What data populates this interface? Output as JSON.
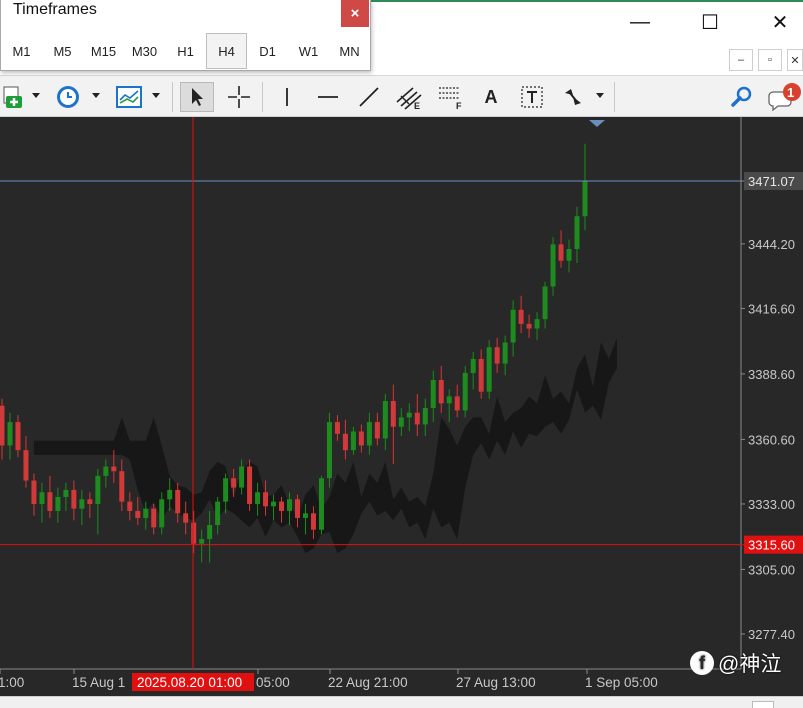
{
  "timeframes": {
    "title": "Timeframes",
    "close_label": "×",
    "items": [
      {
        "label": "M1",
        "active": false
      },
      {
        "label": "M5",
        "active": false
      },
      {
        "label": "M15",
        "active": false
      },
      {
        "label": "M30",
        "active": false
      },
      {
        "label": "H1",
        "active": false
      },
      {
        "label": "H4",
        "active": true
      },
      {
        "label": "D1",
        "active": false
      },
      {
        "label": "W1",
        "active": false
      },
      {
        "label": "MN",
        "active": false
      }
    ]
  },
  "window": {
    "minimize": "—",
    "maximize": "☐",
    "close": "✕",
    "mdi_minimize": "–",
    "mdi_restore": "▫",
    "mdi_close": "✕"
  },
  "toolbar": {
    "tools": [
      "new-chart",
      "periodicity",
      "templates",
      "cursor",
      "crosshair",
      "vertical-line",
      "horizontal-line",
      "trendline",
      "equidistant-channel",
      "fibonacci",
      "text",
      "text-label",
      "arrows"
    ],
    "text_tool_label": "A",
    "notification_count": "1"
  },
  "colors": {
    "bull": "#1f8a1f",
    "bear": "#d03a3a",
    "background": "#282828",
    "cloud": "#141414",
    "price_line": "#6c8ebf",
    "crosshair": "#e01010"
  },
  "chart_data": {
    "type": "candlestick",
    "symbol_timeframe": "H4",
    "price_scale": [
      "3471.07",
      "3444.20",
      "3416.60",
      "3388.60",
      "3360.60",
      "3333.00",
      "3305.00",
      "3277.40"
    ],
    "current_price": "3471.07",
    "crosshair_price": "3315.60",
    "crosshair_time": "2025.08.20 01:00",
    "time_labels": [
      "1:00",
      "15 Aug 1",
      "05:00",
      "22 Aug 21:00",
      "27 Aug 13:00",
      "1 Sep 05:00"
    ],
    "ohlc": [
      [
        3375,
        3378,
        3352,
        3358
      ],
      [
        3358,
        3372,
        3352,
        3368
      ],
      [
        3368,
        3371,
        3353,
        3356
      ],
      [
        3356,
        3362,
        3340,
        3343
      ],
      [
        3343,
        3346,
        3328,
        3333
      ],
      [
        3333,
        3342,
        3325,
        3338
      ],
      [
        3338,
        3345,
        3327,
        3330
      ],
      [
        3330,
        3340,
        3325,
        3336
      ],
      [
        3336,
        3342,
        3330,
        3339
      ],
      [
        3339,
        3343,
        3326,
        3331
      ],
      [
        3331,
        3339,
        3324,
        3335
      ],
      [
        3335,
        3338,
        3327,
        3333
      ],
      [
        3333,
        3348,
        3320,
        3345
      ],
      [
        3345,
        3352,
        3340,
        3349
      ],
      [
        3349,
        3356,
        3342,
        3347
      ],
      [
        3347,
        3352,
        3330,
        3334
      ],
      [
        3334,
        3338,
        3326,
        3330
      ],
      [
        3330,
        3336,
        3324,
        3327
      ],
      [
        3327,
        3334,
        3322,
        3331
      ],
      [
        3331,
        3333,
        3320,
        3323
      ],
      [
        3323,
        3338,
        3320,
        3335
      ],
      [
        3335,
        3344,
        3330,
        3339
      ],
      [
        3339,
        3342,
        3325,
        3329
      ],
      [
        3329,
        3334,
        3320,
        3325
      ],
      [
        3325,
        3330,
        3312,
        3316
      ],
      [
        3316,
        3322,
        3308,
        3318
      ],
      [
        3318,
        3330,
        3308,
        3324
      ],
      [
        3324,
        3336,
        3320,
        3334
      ],
      [
        3334,
        3346,
        3329,
        3344
      ],
      [
        3344,
        3348,
        3336,
        3340
      ],
      [
        3340,
        3352,
        3337,
        3349
      ],
      [
        3349,
        3352,
        3330,
        3333
      ],
      [
        3333,
        3342,
        3328,
        3338
      ],
      [
        3338,
        3343,
        3328,
        3332
      ],
      [
        3332,
        3337,
        3326,
        3334
      ],
      [
        3334,
        3336,
        3325,
        3330
      ],
      [
        3330,
        3338,
        3324,
        3335
      ],
      [
        3335,
        3337,
        3323,
        3327
      ],
      [
        3327,
        3333,
        3320,
        3329
      ],
      [
        3329,
        3332,
        3318,
        3322
      ],
      [
        3322,
        3345,
        3320,
        3344
      ],
      [
        3344,
        3372,
        3340,
        3368
      ],
      [
        3368,
        3371,
        3360,
        3363
      ],
      [
        3363,
        3369,
        3352,
        3356
      ],
      [
        3356,
        3366,
        3354,
        3364
      ],
      [
        3364,
        3367,
        3355,
        3358
      ],
      [
        3358,
        3372,
        3354,
        3368
      ],
      [
        3368,
        3372,
        3358,
        3361
      ],
      [
        3361,
        3380,
        3356,
        3377
      ],
      [
        3377,
        3384,
        3350,
        3366
      ],
      [
        3366,
        3374,
        3362,
        3370
      ],
      [
        3370,
        3376,
        3364,
        3372
      ],
      [
        3372,
        3380,
        3362,
        3367
      ],
      [
        3367,
        3378,
        3362,
        3374
      ],
      [
        3374,
        3390,
        3368,
        3386
      ],
      [
        3386,
        3392,
        3372,
        3376
      ],
      [
        3376,
        3382,
        3368,
        3379
      ],
      [
        3379,
        3384,
        3370,
        3373
      ],
      [
        3373,
        3392,
        3370,
        3389
      ],
      [
        3389,
        3398,
        3382,
        3395
      ],
      [
        3395,
        3399,
        3378,
        3381
      ],
      [
        3381,
        3403,
        3378,
        3400
      ],
      [
        3400,
        3404,
        3389,
        3393
      ],
      [
        3393,
        3405,
        3388,
        3402
      ],
      [
        3402,
        3420,
        3396,
        3416
      ],
      [
        3416,
        3422,
        3406,
        3410
      ],
      [
        3410,
        3414,
        3404,
        3408
      ],
      [
        3408,
        3415,
        3403,
        3412
      ],
      [
        3412,
        3428,
        3408,
        3426
      ],
      [
        3426,
        3447,
        3422,
        3444
      ],
      [
        3444,
        3450,
        3434,
        3437
      ],
      [
        3437,
        3446,
        3432,
        3442
      ],
      [
        3442,
        3460,
        3436,
        3456
      ],
      [
        3456,
        3487,
        3450,
        3471
      ]
    ]
  }
}
